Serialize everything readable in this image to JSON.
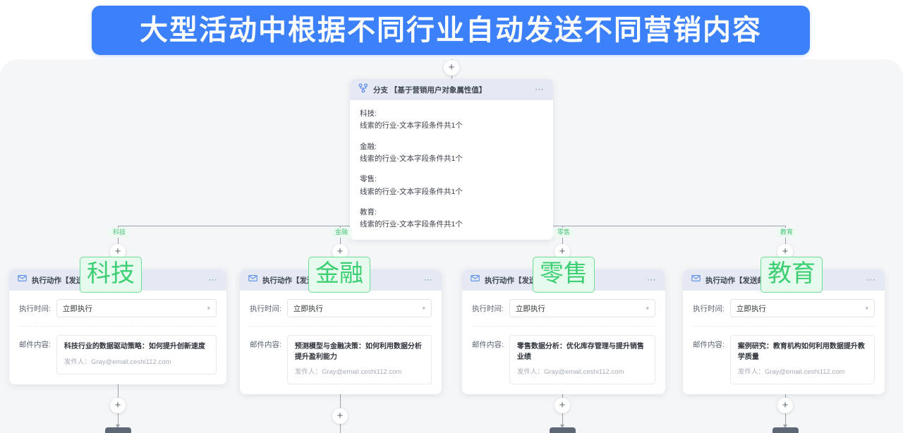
{
  "banner": {
    "title": "大型活动中根据不同行业自动发送不同营销内容"
  },
  "colors": {
    "banner_bg": "#3c80fa",
    "canvas_bg": "#f5f6f8",
    "node_header_bg": "#e4e9f4",
    "edge_label_text": "#4cc47c",
    "annotation_green": "#3ecf74",
    "connector_line": "#9aa1ab"
  },
  "branch_node": {
    "icon": "branch-icon",
    "title": "分支 【基于营销用户对象属性值】",
    "menu_icon": "more-options-icon",
    "groups": [
      {
        "key": "科技:",
        "value": "线索的行业-文本字段条件共1个"
      },
      {
        "key": "金融:",
        "value": "线索的行业-文本字段条件共1个"
      },
      {
        "key": "零售:",
        "value": "线索的行业-文本字段条件共1个"
      },
      {
        "key": "教育:",
        "value": "线索的行业-文本字段条件共1个"
      }
    ]
  },
  "edge_labels": [
    "科技",
    "金融",
    "零售",
    "教育"
  ],
  "annotations": [
    "科技",
    "金融",
    "零售",
    "教育"
  ],
  "action_nodes": [
    {
      "icon": "mail-icon",
      "title": "执行动作【发送邮件】",
      "menu_icon": "more-options-icon",
      "time_label": "执行时间:",
      "time_value": "立即执行",
      "chevron": "chevron-down-icon",
      "content_label": "邮件内容:",
      "subject": "科技行业的数据驱动策略：如何提升创新速度",
      "sender_label": "发件人：",
      "sender": "Gray@email.ceshi112.com"
    },
    {
      "icon": "mail-icon",
      "title": "执行动作【发送邮件】",
      "menu_icon": "more-options-icon",
      "time_label": "执行时间:",
      "time_value": "立即执行",
      "chevron": "chevron-down-icon",
      "content_label": "邮件内容:",
      "subject": "预测模型与金融决策：如何利用数据分析提升盈利能力",
      "sender_label": "发件人：",
      "sender": "Gray@email.ceshi112.com"
    },
    {
      "icon": "mail-icon",
      "title": "执行动作【发送邮件】",
      "menu_icon": "more-options-icon",
      "time_label": "执行时间:",
      "time_value": "立即执行",
      "chevron": "chevron-down-icon",
      "content_label": "邮件内容:",
      "subject": "零售数据分析：优化库存管理与提升销售业绩",
      "sender_label": "发件人：",
      "sender": "Gray@email.ceshi112.com"
    },
    {
      "icon": "mail-icon",
      "title": "执行动作【发送邮件】",
      "menu_icon": "more-options-icon",
      "time_label": "执行时间:",
      "time_value": "立即执行",
      "chevron": "chevron-down-icon",
      "content_label": "邮件内容:",
      "subject": "案例研究：教育机构如何利用数据提升教学质量",
      "sender_label": "发件人：",
      "sender": "Gray@email.ceshi112.com"
    }
  ],
  "add_buttons": {
    "glyph": "+",
    "name": "add-node-button"
  }
}
